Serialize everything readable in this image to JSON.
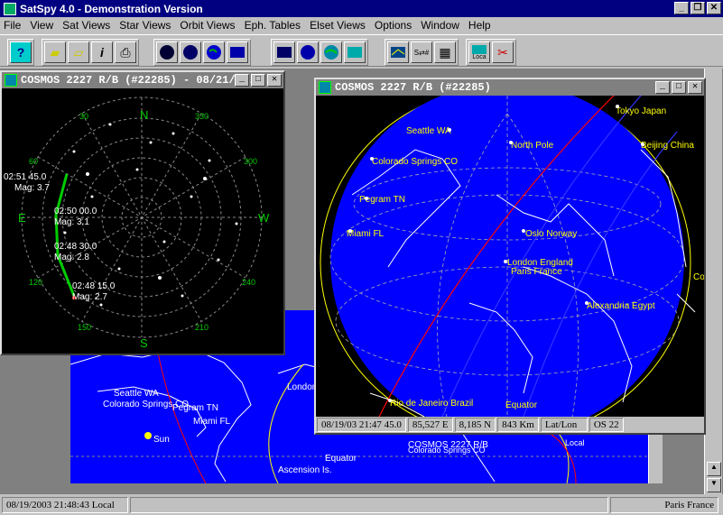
{
  "app": {
    "title": "SatSpy 4.0 - Demonstration Version"
  },
  "menu": [
    "File",
    "View",
    "Sat Views",
    "Star Views",
    "Orbit Views",
    "Eph. Tables",
    "Elset Views",
    "Options",
    "Window",
    "Help"
  ],
  "toolbar": {
    "icons": [
      "help-icon",
      "open-folder-icon",
      "folder-icon",
      "info-icon",
      "print-icon",
      "sky-view-icon",
      "star-view-icon",
      "globe-view-icon",
      "table-view-icon",
      "map-view-icon",
      "sphere-view-icon",
      "world-view-icon",
      "world-map-icon",
      "sat-chart-icon",
      "sat-table-icon",
      "grid-table-icon",
      "location-icon",
      "tools-icon"
    ],
    "location_label": "Loca"
  },
  "sky_window": {
    "title": "COSMOS 2227 R/B (#22285) - 08/21/...",
    "compass": {
      "n": "N",
      "s": "S",
      "e": "E",
      "w": "W"
    },
    "azimuths": [
      "30",
      "330",
      "300",
      "60",
      "120",
      "240",
      "150",
      "210"
    ],
    "passes": [
      {
        "time": "02:51 45.0",
        "mag": "Mag: 3.7"
      },
      {
        "time": "02:50 00.0",
        "mag": "Mag: 3.1"
      },
      {
        "time": "02:48 30.0",
        "mag": "Mag: 2.8"
      },
      {
        "time": "02:48 15.0",
        "mag": "Mag: 2.7"
      }
    ]
  },
  "globe_window": {
    "title": "COSMOS 2227 R/B (#22285)",
    "labels": [
      "Seattle WA",
      "Tokyo Japan",
      "North Pole",
      "Beijing China",
      "Colorado Springs CO",
      "Pegram TN",
      "Miami FL",
      "Oslo Norway",
      "London England",
      "Paris France",
      "Alexandria Egypt",
      "Rio de Janeiro Brazil",
      "Equator",
      "Ascension Is.",
      "Co"
    ],
    "status": {
      "datetime": "08/19/03 21:47 45.0",
      "lon": "85,527 E",
      "lat": "8,185 N",
      "alt": "843 Km",
      "mode": "Lat/Lon",
      "extra": "OS 22"
    }
  },
  "map_window": {
    "labels": [
      "Seattle WA",
      "Colorado Springs CO",
      "Pegram TN",
      "Miami FL",
      "Sun",
      "London",
      "Equator",
      "Ascension Is.",
      "Local",
      "COSMOS 2227 R/B",
      "Colorado Springs CO"
    ]
  },
  "status": {
    "left": "08/19/2003 21:48:43 Local",
    "right": "Paris France"
  }
}
